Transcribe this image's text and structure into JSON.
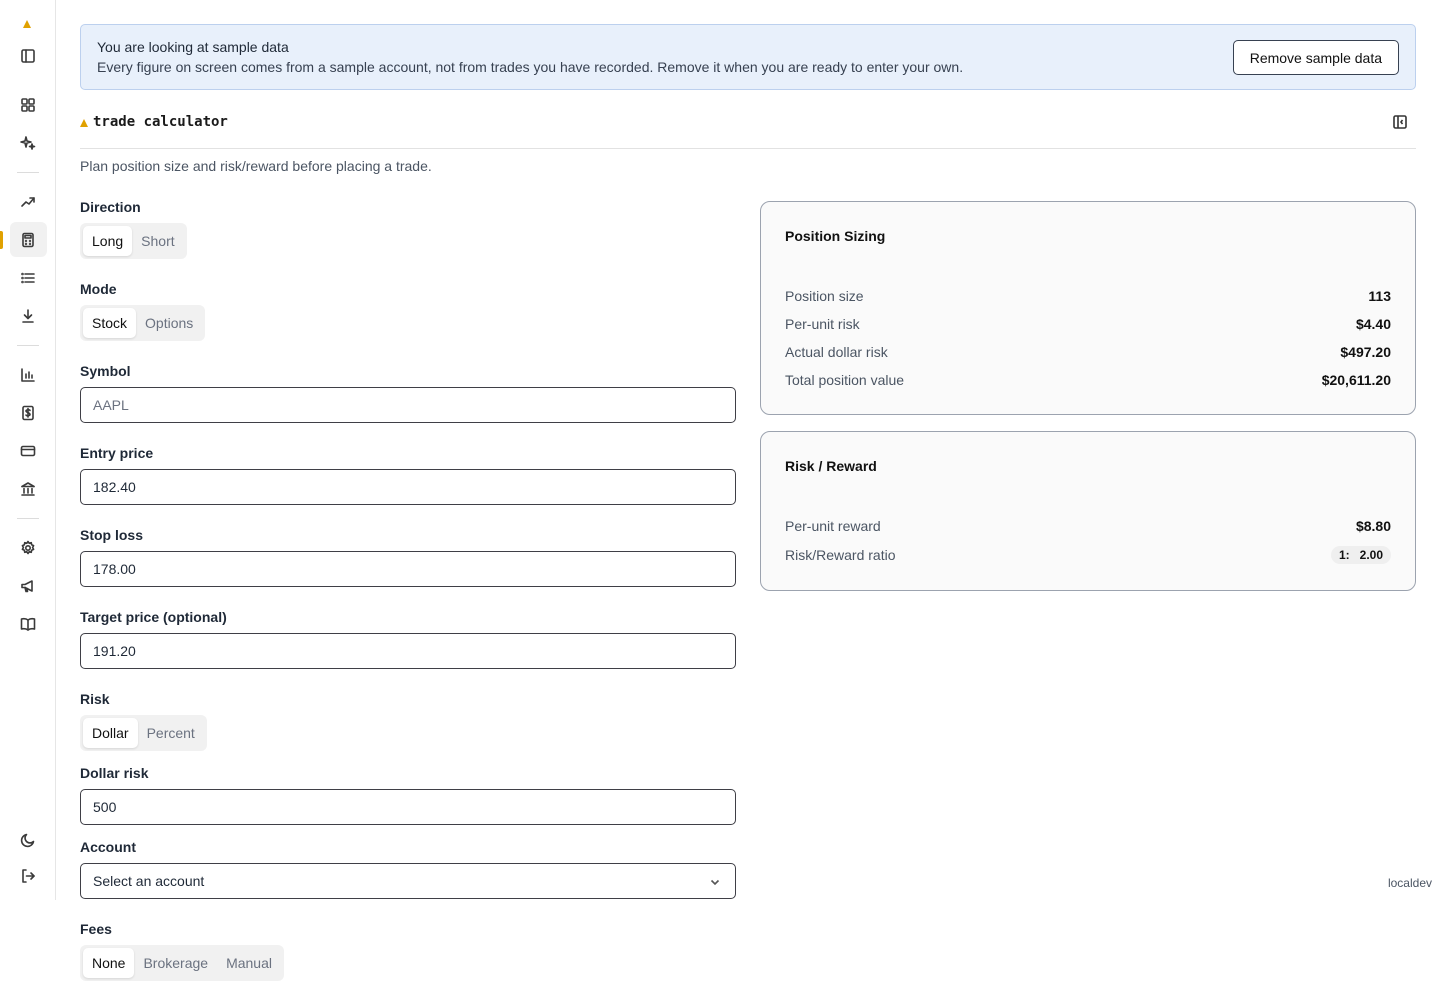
{
  "sidebar": {
    "items": [
      {
        "name": "sidebar-toggle-icon"
      },
      {
        "name": "dashboard-icon"
      },
      {
        "name": "sparkles-icon"
      },
      {
        "name": "trending-up-icon"
      },
      {
        "name": "calculator-icon"
      },
      {
        "name": "list-icon"
      },
      {
        "name": "download-icon"
      },
      {
        "name": "bar-chart-icon"
      },
      {
        "name": "dollar-receipt-icon"
      },
      {
        "name": "credit-card-icon"
      },
      {
        "name": "bank-icon"
      },
      {
        "name": "gear-icon"
      },
      {
        "name": "megaphone-icon"
      },
      {
        "name": "book-icon"
      },
      {
        "name": "moon-icon"
      },
      {
        "name": "logout-icon"
      }
    ],
    "active": "calculator-icon",
    "accent": "#e0a100"
  },
  "banner": {
    "title": "You are looking at sample data",
    "text": "Every figure on screen comes from a sample account, not from trades you have recorded. Remove it when you are ready to enter your own.",
    "button": "Remove sample data"
  },
  "header": {
    "title": "trade calculator",
    "subtitle": "Plan position size and risk/reward before placing a trade."
  },
  "form": {
    "direction": {
      "label": "Direction",
      "options": [
        "Long",
        "Short"
      ],
      "selected": "Long"
    },
    "mode": {
      "label": "Mode",
      "options": [
        "Stock",
        "Options"
      ],
      "selected": "Stock"
    },
    "symbol": {
      "label": "Symbol",
      "placeholder": "AAPL",
      "value": ""
    },
    "entry": {
      "label": "Entry price",
      "value": "182.40"
    },
    "stop": {
      "label": "Stop loss",
      "value": "178.00"
    },
    "target": {
      "label": "Target price (optional)",
      "value": "191.20"
    },
    "risk": {
      "label": "Risk",
      "options": [
        "Dollar",
        "Percent"
      ],
      "selected": "Dollar"
    },
    "dollar_risk": {
      "label": "Dollar risk",
      "value": "500"
    },
    "account": {
      "label": "Account",
      "placeholder": "Select an account"
    },
    "fees": {
      "label": "Fees",
      "options": [
        "None",
        "Brokerage",
        "Manual"
      ],
      "selected": "None"
    }
  },
  "position_sizing": {
    "title": "Position Sizing",
    "rows": [
      {
        "label": "Position size",
        "value": "113"
      },
      {
        "label": "Per-unit risk",
        "value": "$4.40"
      },
      {
        "label": "Actual dollar risk",
        "value": "$497.20"
      },
      {
        "label": "Total position value",
        "value": "$20,611.20"
      }
    ]
  },
  "risk_reward": {
    "title": "Risk / Reward",
    "rows": [
      {
        "label": "Per-unit reward",
        "value": "$8.80"
      }
    ],
    "ratio_label": "Risk/Reward ratio",
    "ratio_left": "1:",
    "ratio_right": "2.00"
  },
  "footer": {
    "env": "localdev"
  }
}
